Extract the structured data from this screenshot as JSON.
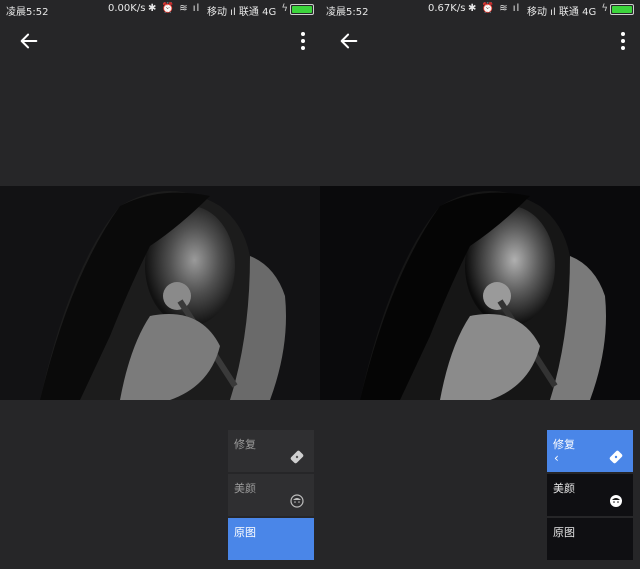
{
  "left": {
    "status": {
      "time": "凌晨5:52",
      "speed": "0.00K/s",
      "carrier1": "移动",
      "carrier2": "联通",
      "network": "4G"
    },
    "menu": [
      {
        "label": "修复",
        "icon": "bandage-icon"
      },
      {
        "label": "美颜",
        "icon": "face-icon"
      },
      {
        "label": "原图",
        "icon": ""
      }
    ]
  },
  "right": {
    "status": {
      "time": "凌晨5:52",
      "speed": "0.67K/s",
      "carrier1": "移动",
      "carrier2": "联通",
      "network": "4G"
    },
    "menu": [
      {
        "label": "修复",
        "icon": "bandage-icon"
      },
      {
        "label": "美颜",
        "icon": "face-icon"
      },
      {
        "label": "原图",
        "icon": ""
      }
    ]
  },
  "colors": {
    "accent": "#4a86e8",
    "background": "#262628",
    "battery": "#3cd43c"
  }
}
